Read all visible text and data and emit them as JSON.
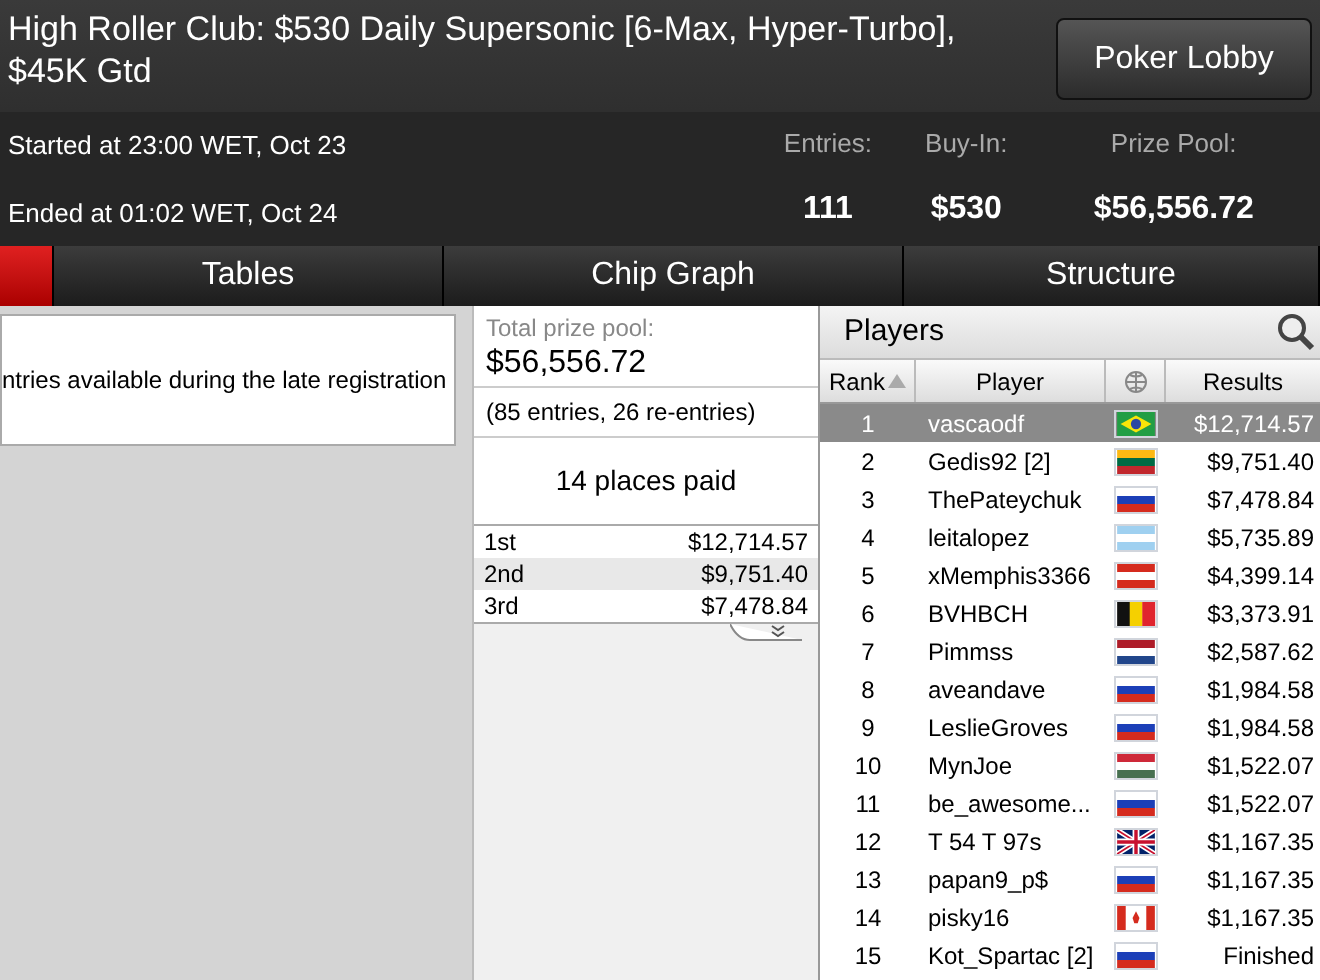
{
  "header": {
    "title": "High Roller Club: $530 Daily Supersonic [6-Max, Hyper-Turbo], $45K Gtd",
    "lobby_button": "Poker Lobby",
    "started": "Started at 23:00 WET, Oct 23",
    "ended": "Ended at 01:02 WET, Oct 24",
    "stats": [
      {
        "label": "Entries:",
        "value": "111"
      },
      {
        "label": "Buy-In:",
        "value": "$530"
      },
      {
        "label": "Prize Pool:",
        "value": "$56,556.72"
      }
    ]
  },
  "tabs": [
    {
      "selected": true
    },
    {
      "label": "Tables",
      "selected": false
    },
    {
      "label": "Chip Graph",
      "selected": false
    },
    {
      "label": "Structure",
      "selected": false
    }
  ],
  "info": {
    "text": "ntries available during the late registration"
  },
  "prizes": {
    "total_label": "Total prize pool:",
    "total": "$56,556.72",
    "entries": "(85 entries, 26 re-entries)",
    "places": "14 places paid",
    "payouts": [
      {
        "place": "1st",
        "amount": "$12,714.57"
      },
      {
        "place": "2nd",
        "amount": "$9,751.40"
      },
      {
        "place": "3rd",
        "amount": "$7,478.84"
      }
    ]
  },
  "players": {
    "title": "Players",
    "columns": [
      "Rank",
      "Player",
      "Results"
    ],
    "rows": [
      {
        "rank": "1",
        "name": "vascaodf",
        "kind": "brazil",
        "result": "$12,714.57",
        "selected": true
      },
      {
        "rank": "2",
        "name": "Gedis92 [2]",
        "kind": "lithuania",
        "result": "$9,751.40",
        "selected": false
      },
      {
        "rank": "3",
        "name": "ThePateychuk",
        "kind": "russia",
        "result": "$7,478.84",
        "selected": false
      },
      {
        "rank": "4",
        "name": "leitalopez",
        "kind": "argentina",
        "result": "$5,735.89",
        "selected": false
      },
      {
        "rank": "5",
        "name": "xMemphis3366",
        "kind": "austria",
        "result": "$4,399.14",
        "selected": false
      },
      {
        "rank": "6",
        "name": "BVHBCH",
        "kind": "belgium",
        "result": "$3,373.91",
        "selected": false
      },
      {
        "rank": "7",
        "name": "Pimmss",
        "kind": "netherlands",
        "result": "$2,587.62",
        "selected": false
      },
      {
        "rank": "8",
        "name": "aveandave",
        "kind": "russia",
        "result": "$1,984.58",
        "selected": false
      },
      {
        "rank": "9",
        "name": "LeslieGroves",
        "kind": "russia",
        "result": "$1,984.58",
        "selected": false
      },
      {
        "rank": "10",
        "name": "MynJoe",
        "kind": "hungary",
        "result": "$1,522.07",
        "selected": false
      },
      {
        "rank": "11",
        "name": "be_awesome...",
        "kind": "russia",
        "result": "$1,522.07",
        "selected": false
      },
      {
        "rank": "12",
        "name": "T 54 T 97s",
        "kind": "uk",
        "result": "$1,167.35",
        "selected": false
      },
      {
        "rank": "13",
        "name": "papan9_p$",
        "kind": "russia",
        "result": "$1,167.35",
        "selected": false
      },
      {
        "rank": "14",
        "name": "pisky16",
        "kind": "canada",
        "result": "$1,167.35",
        "selected": false
      },
      {
        "rank": "15",
        "name": "Kot_Spartac [2]",
        "kind": "russia",
        "result": "Finished",
        "selected": false
      }
    ]
  }
}
